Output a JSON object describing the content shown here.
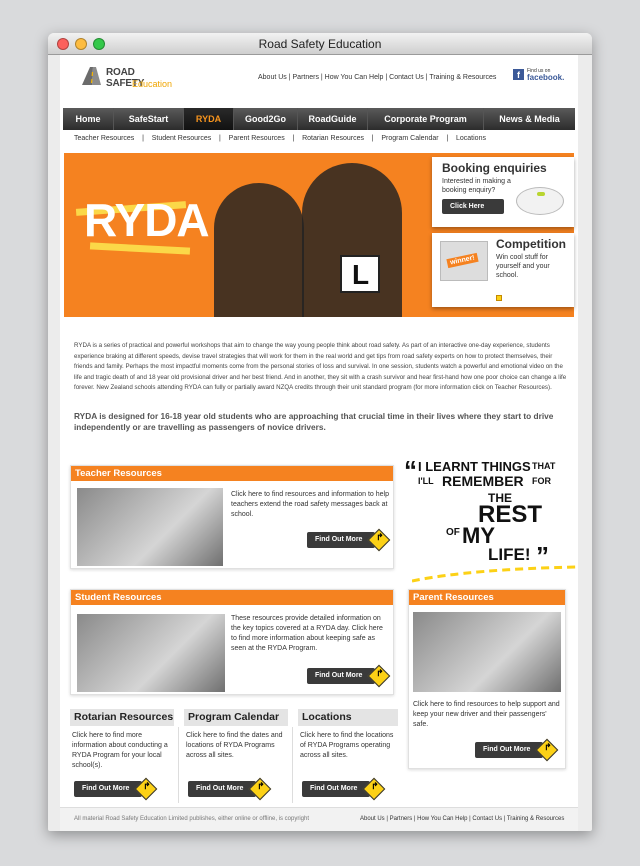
{
  "window": {
    "title": "Road Safety Education"
  },
  "logo": {
    "line1": "ROAD SAFETY",
    "line2": "Education"
  },
  "top_links": "About Us  |  Partners  |  How You Can Help  |  Contact Us  |  Training & Resources",
  "facebook": {
    "small": "Find us on",
    "name": "facebook."
  },
  "nav": [
    "Home",
    "SafeStart",
    "RYDA",
    "Good2Go",
    "RoadGuide",
    "Corporate Program",
    "News & Media"
  ],
  "nav_active": "RYDA",
  "subnav": [
    "Teacher Resources",
    "Student Resources",
    "Parent Resources",
    "Rotarian Resources",
    "Program Calendar",
    "Locations"
  ],
  "hero": {
    "title": "RYDA",
    "plate": "L"
  },
  "booking": {
    "title": "Booking enquiries",
    "text": "Interested in making a booking enquiry?",
    "button": "Click Here"
  },
  "competition": {
    "title": "Competition",
    "text": "Win cool stuff for yourself and your school.",
    "label": "winner!"
  },
  "intro": "RYDA is a series of practical and powerful workshops that aim to change the way young people think about road safety.  As part of an interactive one-day experience, students experience braking at different speeds, devise travel strategies that will work for them in the real world and get tips from road safety experts on how to protect themselves, their friends and family.  Perhaps the most impactful moments come from the personal stories of loss and survival.  In one session, students watch a powerful and emotional video on the life and tragic death of and 18 year old provisional driver and her best friend.   And in another, they sit with a crash survivor and hear first-hand how one poor choice can change a life forever.  New Zealand schools attending RYDA can fully or partially award NZQA credits through their unit standard program (for more information click on Teacher Resources).",
  "highlight": "RYDA is designed for 16-18 year old students who are approaching that crucial time in their lives where they start to drive independently or are travelling as passengers of novice drivers.",
  "teacher": {
    "title": "Teacher Resources",
    "text": "Click here to find resources and information to help teachers extend the road safety messages back at school.",
    "button": "Find Out More"
  },
  "student": {
    "title": "Student Resources",
    "text": "These resources provide detailed information on the key topics covered at a RYDA day. Click here to find more information about keeping safe as seen at the RYDA Program.",
    "button": "Find Out More"
  },
  "parent": {
    "title": "Parent Resources",
    "text": "Click here to find resources to help support and keep your new driver and their passengers' safe.",
    "button": "Find Out More"
  },
  "quote": {
    "open": "“",
    "l1a": "I LEARNT THINGS",
    "l1b": "THAT",
    "l2a": "I'LL",
    "l2b": "REMEMBER",
    "l2c": "FOR",
    "l3": "THE",
    "l4": "REST",
    "l5a": "OF",
    "l5b": "MY",
    "l6": "LIFE!",
    "close": "”"
  },
  "rotarian": {
    "title": "Rotarian Resources",
    "text": "Click here to find more information about conducting a RYDA Program for your local school(s).",
    "button": "Find Out More"
  },
  "calendar": {
    "title": "Program Calendar",
    "text": "Click here to find the dates and locations of RYDA Programs across all sites.",
    "button": "Find Out More"
  },
  "locations": {
    "title": "Locations",
    "text": "Click here to find the locations of RYDA Programs operating across all sites.",
    "button": "Find Out More"
  },
  "footer": {
    "left": "All material Road Safety Education Limited publishes, either online or offline, is copyright",
    "right": "About Us  |  Partners  |  How You Can Help  |  Contact Us  |  Training & Resources"
  },
  "colors": {
    "brand_orange": "#f58220",
    "accent_yellow": "#fcd116",
    "dark": "#3a3a3a"
  }
}
